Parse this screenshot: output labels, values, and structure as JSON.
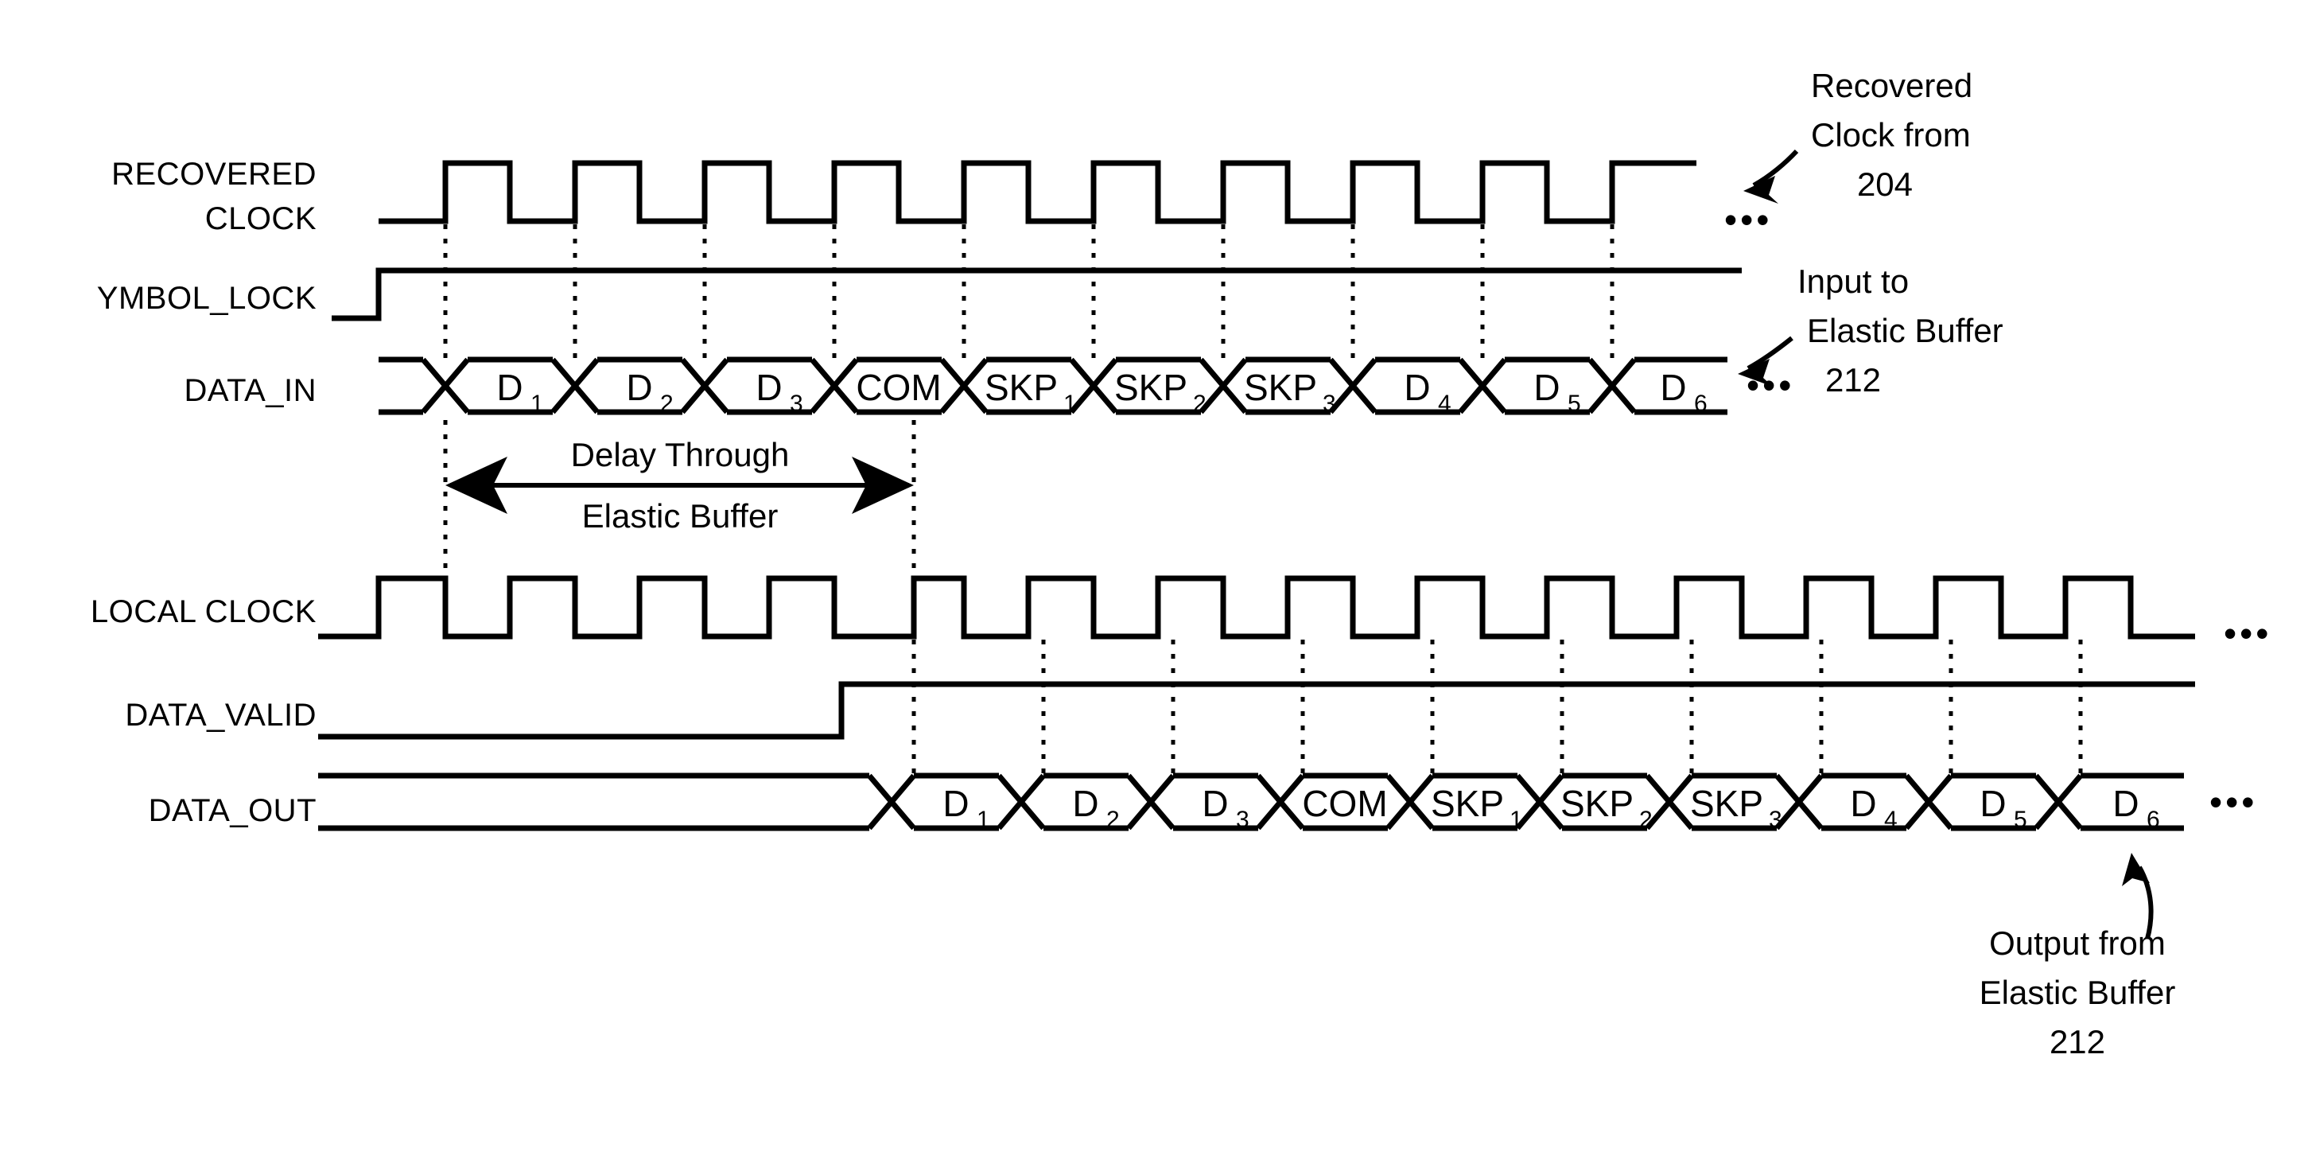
{
  "diagram": {
    "title": "Elastic Buffer Timing Diagram",
    "stroke_color": "#000000",
    "background_color": "#ffffff",
    "ellipsis": "•••"
  },
  "signals": {
    "recovered_clock": {
      "label_line1": "RECOVERED",
      "label_line2": "CLOCK"
    },
    "symbol_lock": {
      "label": "YMBOL_LOCK"
    },
    "data_in": {
      "label": "DATA_IN"
    },
    "local_clock": {
      "label": "LOCAL CLOCK"
    },
    "data_valid": {
      "label": "DATA_VALID"
    },
    "data_out": {
      "label": "DATA_OUT"
    }
  },
  "data_in_cells": [
    {
      "text": "D",
      "sub": "1"
    },
    {
      "text": "D",
      "sub": "2"
    },
    {
      "text": "D",
      "sub": "3"
    },
    {
      "text": "COM",
      "sub": ""
    },
    {
      "text": "SKP",
      "sub": "1"
    },
    {
      "text": "SKP",
      "sub": "2"
    },
    {
      "text": "SKP",
      "sub": "3"
    },
    {
      "text": "D",
      "sub": "4"
    },
    {
      "text": "D",
      "sub": "5"
    },
    {
      "text": "D",
      "sub": "6"
    }
  ],
  "data_out_cells": [
    {
      "text": "D",
      "sub": "1"
    },
    {
      "text": "D",
      "sub": "2"
    },
    {
      "text": "D",
      "sub": "3"
    },
    {
      "text": "COM",
      "sub": ""
    },
    {
      "text": "SKP",
      "sub": "1"
    },
    {
      "text": "SKP",
      "sub": "2"
    },
    {
      "text": "SKP",
      "sub": "3"
    },
    {
      "text": "D",
      "sub": "4"
    },
    {
      "text": "D",
      "sub": "5"
    },
    {
      "text": "D",
      "sub": "6"
    }
  ],
  "annotations": {
    "recovered_clock_note": {
      "line1": "Recovered",
      "line2": "Clock from",
      "line3": "204"
    },
    "input_note": {
      "line1": "Input to",
      "line2": "Elastic Buffer",
      "line3": "212"
    },
    "delay_note": {
      "line1": "Delay Through",
      "line2": "Elastic Buffer"
    },
    "output_note": {
      "line1": "Output from",
      "line2": "Elastic Buffer",
      "line3": "212"
    }
  },
  "ellipses": {
    "recovered_clock": "•••",
    "data_in": "•••",
    "local_clock": "•••",
    "data_out": "•••"
  }
}
